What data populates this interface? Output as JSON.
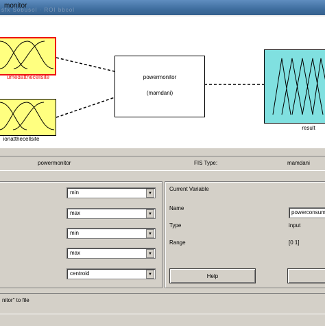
{
  "window": {
    "title": "monitor",
    "faint_title": "sfx Sobusol · ROI bbcol"
  },
  "diagram": {
    "input1": {
      "label": "umedatthecellsite"
    },
    "input2": {
      "label": "ionatthecellsite"
    },
    "system": {
      "name": "powermonitor",
      "type": "(mamdani)"
    },
    "output": {
      "label": "result"
    },
    "colors": {
      "input_fill": "#ffff80",
      "output_fill": "#80e0e0",
      "selected_border": "#ee1111"
    }
  },
  "info": {
    "fis_name": "powermonitor",
    "fis_type_label": "FIS Type:",
    "fis_type": "mamdani"
  },
  "methods": {
    "dropdowns": [
      "min",
      "max",
      "min",
      "max",
      "centroid"
    ]
  },
  "current_variable": {
    "title": "Current Variable",
    "name_label": "Name",
    "name_value": "powerconsum",
    "type_label": "Type",
    "type_value": "input",
    "range_label": "Range",
    "range_value": "[0 1]"
  },
  "buttons": {
    "help": "Help"
  },
  "status": {
    "text": "nitor\" to file"
  }
}
